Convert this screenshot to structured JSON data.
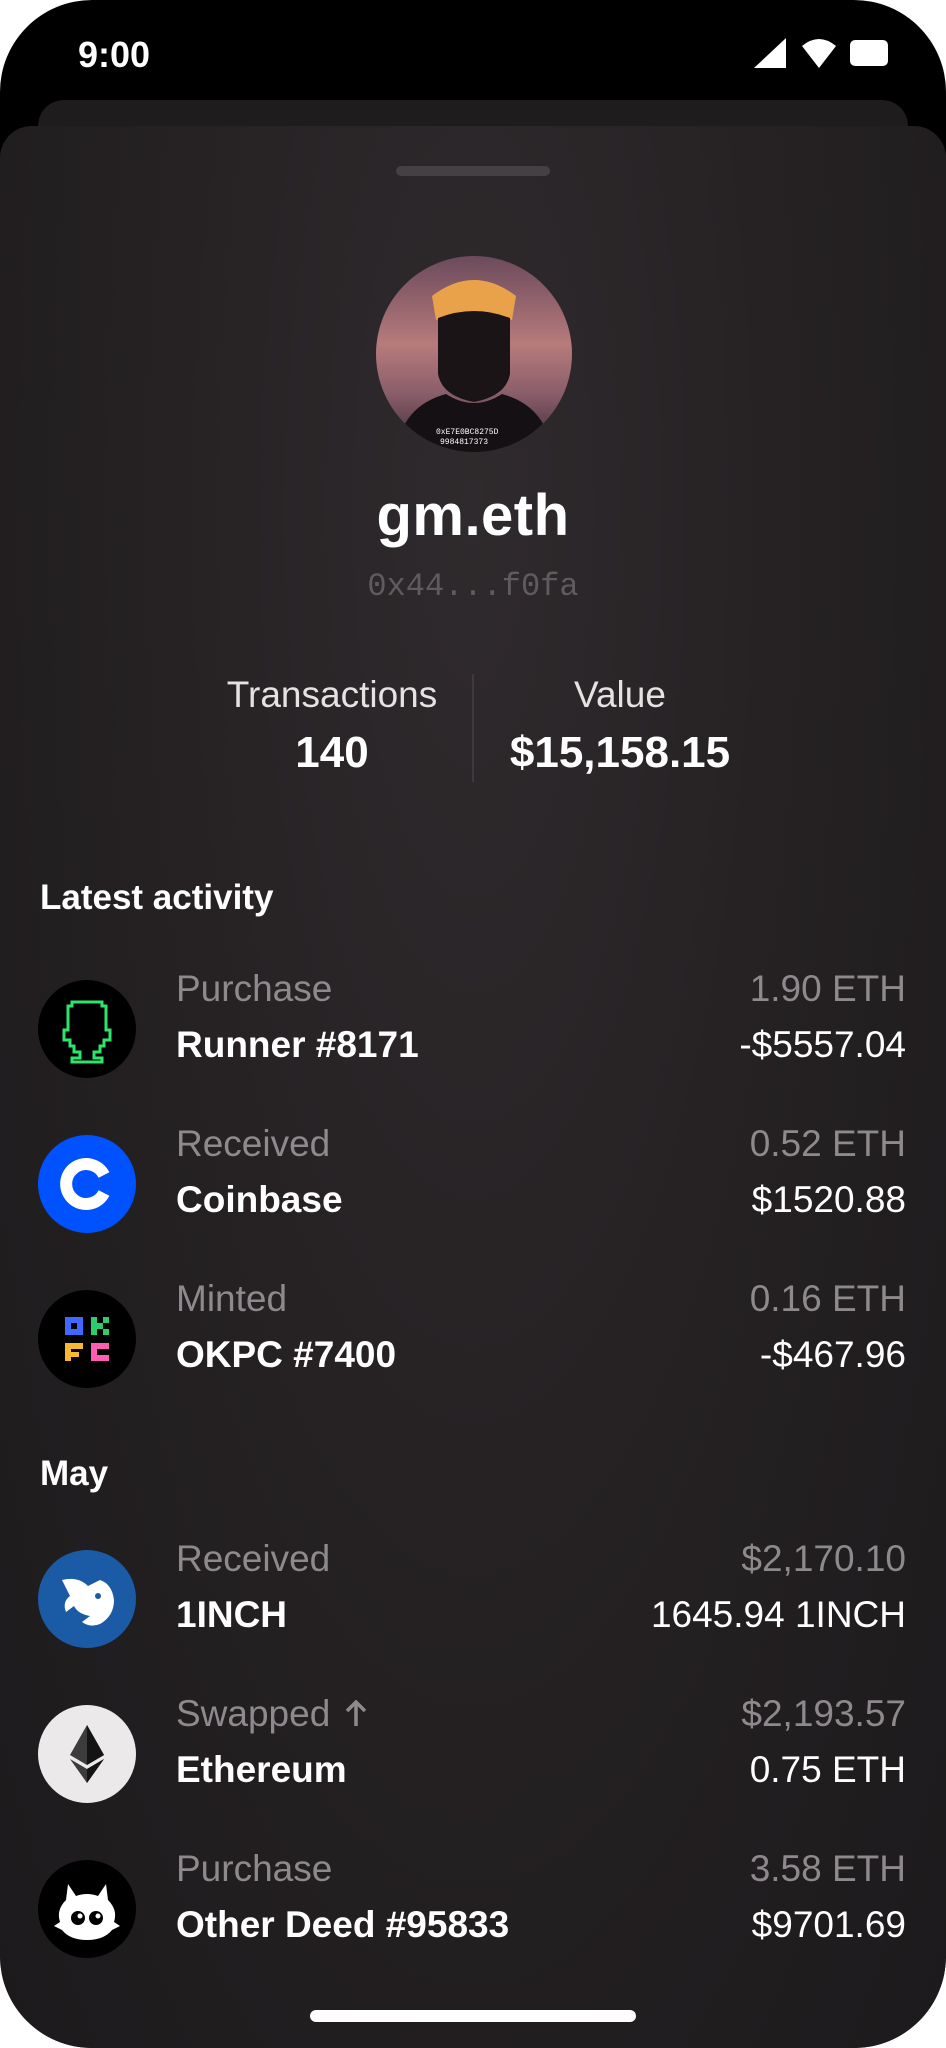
{
  "status_bar": {
    "time": "9:00",
    "icons": [
      "signal-icon",
      "wifi-icon",
      "battery-icon"
    ]
  },
  "profile": {
    "name": "gm.eth",
    "address": "0x44...f0fa",
    "avatar_icon": "profile-avatar"
  },
  "stats": {
    "transactions_label": "Transactions",
    "transactions_value": "140",
    "value_label": "Value",
    "value_value": "$15,158.15"
  },
  "sections": {
    "latest_title": "Latest activity",
    "may_title": "May"
  },
  "latest_activity": [
    {
      "label": "Purchase",
      "name": "Runner #8171",
      "secondary": "1.90 ETH",
      "primary": "-$5557.04",
      "icon": "runner-nft-icon"
    },
    {
      "label": "Received",
      "name": "Coinbase",
      "secondary": "0.52 ETH",
      "primary": "$1520.88",
      "icon": "coinbase-icon"
    },
    {
      "label": "Minted",
      "name": "OKPC #7400",
      "secondary": "0.16 ETH",
      "primary": "-$467.96",
      "icon": "okpc-icon"
    }
  ],
  "may_activity": [
    {
      "label": "Received",
      "name": "1INCH",
      "secondary": "$2,170.10",
      "primary": "1645.94 1INCH",
      "icon": "1inch-icon"
    },
    {
      "label": "Swapped",
      "name": "Ethereum",
      "secondary": "$2,193.57",
      "primary": "0.75 ETH",
      "icon": "ethereum-icon",
      "label_icon": "arrow-up-icon"
    },
    {
      "label": "Purchase",
      "name": "Other Deed #95833",
      "secondary": "3.58 ETH",
      "primary": "$9701.69",
      "icon": "otherdeed-icon"
    }
  ],
  "colors": {
    "background": "#000000",
    "sheet": "#262224",
    "text_primary": "#ffffff",
    "text_secondary": "#8e898c",
    "coinbase_blue": "#0052ff",
    "oneinch_blue": "#1b5ba6"
  }
}
